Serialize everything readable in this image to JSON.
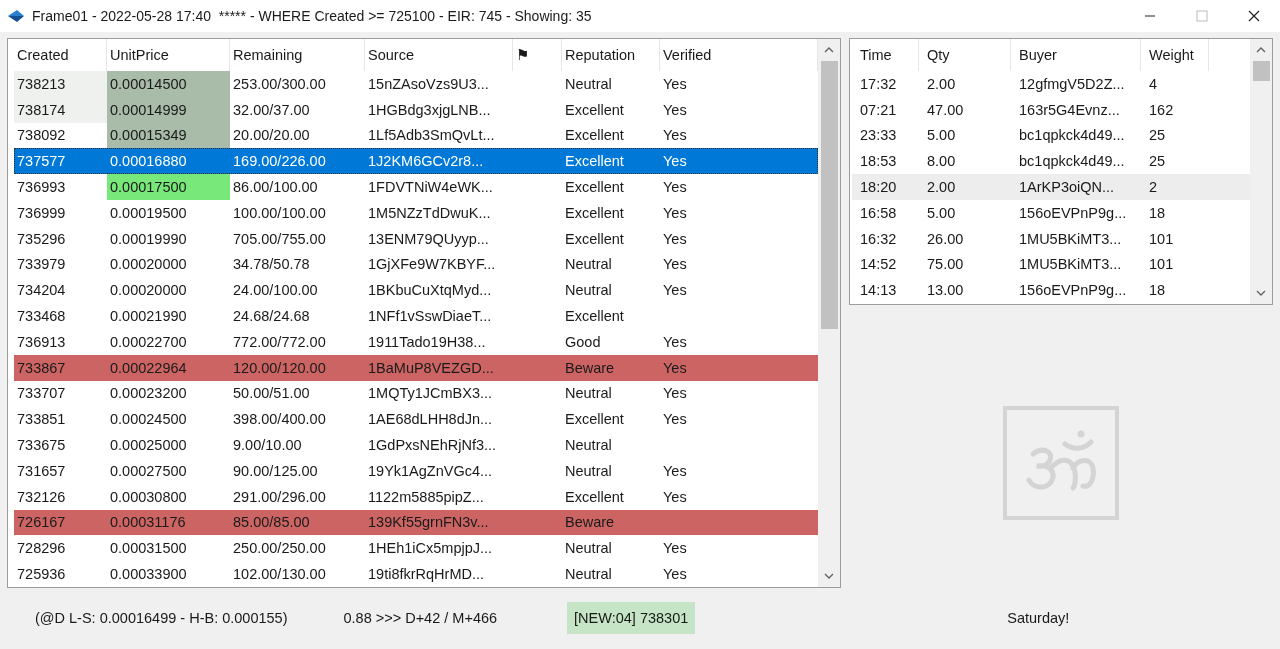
{
  "window": {
    "title": "Frame01 - 2022-05-28 17:40  ***** - WHERE Created >= 725100 - EIR: 745 - Showing: 35"
  },
  "orders": {
    "columns": [
      "Created",
      "UnitPrice",
      "Remaining",
      "Source",
      "⚑",
      "Reputation",
      "Verified"
    ],
    "rows": [
      {
        "created": "738213",
        "unit_price": "0.00014500",
        "remaining": "253.00/300.00",
        "source": "15nZAsoVzs9U3...",
        "reputation": "Neutral",
        "verified": "Yes",
        "selected": false,
        "kind": "normal",
        "created_shaded": true,
        "color": "#a9bba9"
      },
      {
        "created": "738174",
        "unit_price": "0.00014999",
        "remaining": "32.00/37.00",
        "source": "1HGBdg3xjgLNB...",
        "reputation": "Excellent",
        "verified": "Yes",
        "selected": false,
        "kind": "normal",
        "created_shaded": true,
        "color": "#a9bba9"
      },
      {
        "created": "738092",
        "unit_price": "0.00015349",
        "remaining": "20.00/20.00",
        "source": "1Lf5Adb3SmQvLt...",
        "reputation": "Excellent",
        "verified": "Yes",
        "selected": false,
        "kind": "normal",
        "created_shaded": false,
        "color": "#a9bba9"
      },
      {
        "created": "737577",
        "unit_price": "0.00016880",
        "remaining": "169.00/226.00",
        "source": "1J2KM6GCv2r8...",
        "reputation": "Excellent",
        "verified": "Yes",
        "selected": true,
        "kind": "normal",
        "created_shaded": false
      },
      {
        "created": "736993",
        "unit_price": "0.00017500",
        "remaining": "86.00/100.00",
        "source": "1FDVTNiW4eWK...",
        "reputation": "Excellent",
        "verified": "Yes",
        "selected": false,
        "kind": "normal",
        "created_shaded": false,
        "color": "#77e879"
      },
      {
        "created": "736999",
        "unit_price": "0.00019500",
        "remaining": "100.00/100.00",
        "source": "1M5NZzTdDwuK...",
        "reputation": "Excellent",
        "verified": "Yes",
        "selected": false,
        "kind": "normal",
        "created_shaded": false
      },
      {
        "created": "735296",
        "unit_price": "0.00019990",
        "remaining": "705.00/755.00",
        "source": "13ENM79QUyyp...",
        "reputation": "Excellent",
        "verified": "Yes",
        "selected": false,
        "kind": "normal",
        "created_shaded": false
      },
      {
        "created": "733979",
        "unit_price": "0.00020000",
        "remaining": "34.78/50.78",
        "source": "1GjXFe9W7KBYF...",
        "reputation": "Neutral",
        "verified": "Yes",
        "selected": false,
        "kind": "normal",
        "created_shaded": false
      },
      {
        "created": "734204",
        "unit_price": "0.00020000",
        "remaining": "24.00/100.00",
        "source": "1BKbuCuXtqMyd...",
        "reputation": "Neutral",
        "verified": "Yes",
        "selected": false,
        "kind": "normal",
        "created_shaded": false
      },
      {
        "created": "733468",
        "unit_price": "0.00021990",
        "remaining": "24.68/24.68",
        "source": "1NFf1vSswDiaeT...",
        "reputation": "Excellent",
        "selected": false,
        "kind": "normal",
        "created_shaded": false
      },
      {
        "created": "736913",
        "unit_price": "0.00022700",
        "remaining": "772.00/772.00",
        "source": "1911Tado19H38...",
        "reputation": "Good",
        "verified": "Yes",
        "selected": false,
        "kind": "normal",
        "created_shaded": false
      },
      {
        "created": "733867",
        "unit_price": "0.00022964",
        "remaining": "120.00/120.00",
        "source": "1BaMuP8VEZGD...",
        "reputation": "Beware",
        "verified": "Yes",
        "selected": false,
        "kind": "beware",
        "created_shaded": false
      },
      {
        "created": "733707",
        "unit_price": "0.00023200",
        "remaining": "50.00/51.00",
        "source": "1MQTy1JCmBX3...",
        "reputation": "Neutral",
        "verified": "Yes",
        "selected": false,
        "kind": "normal",
        "created_shaded": false
      },
      {
        "created": "733851",
        "unit_price": "0.00024500",
        "remaining": "398.00/400.00",
        "source": "1AE68dLHH8dJn...",
        "reputation": "Excellent",
        "verified": "Yes",
        "selected": false,
        "kind": "normal",
        "created_shaded": false
      },
      {
        "created": "733675",
        "unit_price": "0.00025000",
        "remaining": "9.00/10.00",
        "source": "1GdPxsNEhRjNf3...",
        "reputation": "Neutral",
        "selected": false,
        "kind": "normal",
        "created_shaded": false
      },
      {
        "created": "731657",
        "unit_price": "0.00027500",
        "remaining": "90.00/125.00",
        "source": "19Yk1AgZnVGc4...",
        "reputation": "Neutral",
        "verified": "Yes",
        "selected": false,
        "kind": "normal",
        "created_shaded": false
      },
      {
        "created": "732126",
        "unit_price": "0.00030800",
        "remaining": "291.00/296.00",
        "source": "1122m5885pipZ...",
        "reputation": "Excellent",
        "verified": "Yes",
        "selected": false,
        "kind": "normal",
        "created_shaded": false
      },
      {
        "created": "726167",
        "unit_price": "0.00031176",
        "remaining": "85.00/85.00",
        "source": "139Kf55grnFN3v...",
        "reputation": "Beware",
        "selected": false,
        "kind": "beware",
        "created_shaded": false
      },
      {
        "created": "728296",
        "unit_price": "0.00031500",
        "remaining": "250.00/250.00",
        "source": "1HEh1iCx5mpjpJ...",
        "reputation": "Neutral",
        "verified": "Yes",
        "selected": false,
        "kind": "normal",
        "created_shaded": false
      },
      {
        "created": "725936",
        "unit_price": "0.00033900",
        "remaining": "102.00/130.00",
        "source": "19ti8fkrRqHrMD...",
        "reputation": "Neutral",
        "verified": "Yes",
        "selected": false,
        "kind": "normal",
        "created_shaded": false
      }
    ]
  },
  "trades": {
    "columns": [
      "Time",
      "Qty",
      "Buyer",
      "Weight"
    ],
    "rows": [
      {
        "time": "17:32",
        "qty": "2.00",
        "buyer": "12gfmgV5D2Z...",
        "weight": "4",
        "selected": false
      },
      {
        "time": "07:21",
        "qty": "47.00",
        "buyer": "163r5G4Evnz...",
        "weight": "162",
        "selected": false
      },
      {
        "time": "23:33",
        "qty": "5.00",
        "buyer": "bc1qpkck4d49...",
        "weight": "25",
        "selected": false
      },
      {
        "time": "18:53",
        "qty": "8.00",
        "buyer": "bc1qpkck4d49...",
        "weight": "25",
        "selected": false
      },
      {
        "time": "18:20",
        "qty": "2.00",
        "buyer": "1ArKP3oiQN...",
        "weight": "2",
        "selected": true
      },
      {
        "time": "16:58",
        "qty": "5.00",
        "buyer": "156oEVPnP9g...",
        "weight": "18",
        "selected": false
      },
      {
        "time": "16:32",
        "qty": "26.00",
        "buyer": "1MU5BKiMT3...",
        "weight": "101",
        "selected": false
      },
      {
        "time": "14:52",
        "qty": "75.00",
        "buyer": "1MU5BKiMT3...",
        "weight": "101",
        "selected": false
      },
      {
        "time": "14:13",
        "qty": "13.00",
        "buyer": "156oEVPnP9g...",
        "weight": "18",
        "selected": false
      }
    ]
  },
  "status_bar": {
    "spread": "(@D L-S: 0.00016499 - H-B: 0.000155)",
    "ratio": "0.88 >>> D+42 / M+466",
    "new_badge": "[NEW:04] 738301",
    "day": "Saturday!"
  }
}
